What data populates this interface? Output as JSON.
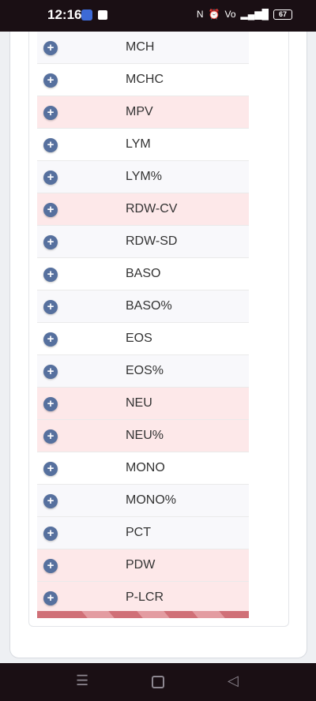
{
  "status_bar": {
    "time": "12:16",
    "battery": "67",
    "icons": [
      "nfc-icon",
      "alarm-icon",
      "volte-icon",
      "signal-icon"
    ]
  },
  "rows": [
    {
      "label": "MCH",
      "style": "light"
    },
    {
      "label": "MCHC",
      "style": "white"
    },
    {
      "label": "MPV",
      "style": "pink"
    },
    {
      "label": "LYM",
      "style": "white"
    },
    {
      "label": "LYM%",
      "style": "light"
    },
    {
      "label": "RDW-CV",
      "style": "pink"
    },
    {
      "label": "RDW-SD",
      "style": "light"
    },
    {
      "label": "BASO",
      "style": "white"
    },
    {
      "label": "BASO%",
      "style": "light"
    },
    {
      "label": "EOS",
      "style": "white"
    },
    {
      "label": "EOS%",
      "style": "light"
    },
    {
      "label": "NEU",
      "style": "pink"
    },
    {
      "label": "NEU%",
      "style": "pink"
    },
    {
      "label": "MONO",
      "style": "white"
    },
    {
      "label": "MONO%",
      "style": "light"
    },
    {
      "label": "PCT",
      "style": "light"
    },
    {
      "label": "PDW",
      "style": "pink"
    },
    {
      "label": "P-LCR",
      "style": "pink"
    }
  ],
  "expand_symbol": "+",
  "nav": {
    "menu": "☰",
    "back": "◁"
  },
  "colors": {
    "pink_row": "#fde8e9",
    "light_row": "#f8f8fb",
    "expand_button": "#56709e",
    "stripe": "#d07077"
  }
}
